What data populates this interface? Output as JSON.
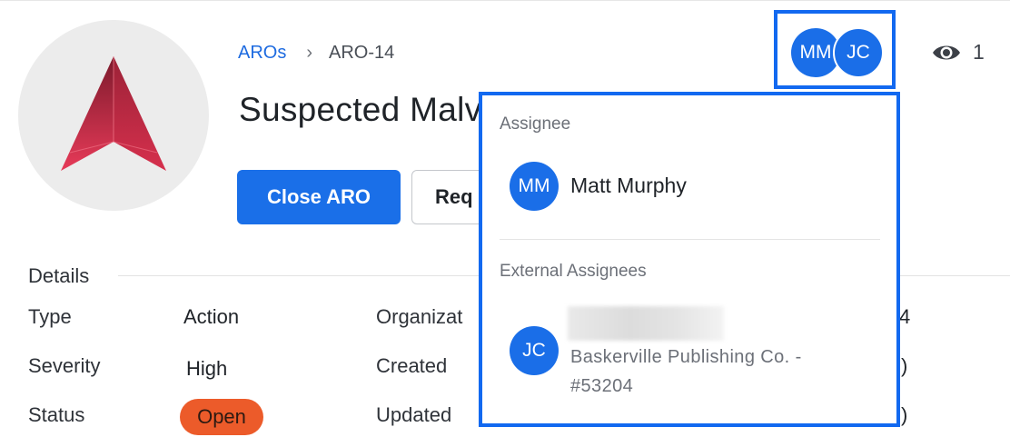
{
  "breadcrumb": {
    "parent": "AROs",
    "separator": "›",
    "current": "ARO-14"
  },
  "title": "Suspected Malv",
  "actions": {
    "primary_label": "Close ARO",
    "secondary_label": "Req"
  },
  "details": {
    "heading": "Details",
    "rows": [
      {
        "label": "Type",
        "value": "Action"
      },
      {
        "label": "Severity",
        "value": "High"
      },
      {
        "label": "Status",
        "value": "Open"
      }
    ],
    "col2_labels": [
      "Organizat",
      "Created",
      "Updated"
    ],
    "col3_fragments": [
      "4",
      ")",
      ")"
    ]
  },
  "assignees": {
    "avatars": [
      "MM",
      "JC"
    ],
    "viewer_icon": "eye-icon",
    "viewer_count": "1"
  },
  "dropdown": {
    "assignee_heading": "Assignee",
    "assignee": {
      "initials": "MM",
      "name": "Matt Murphy"
    },
    "external_heading": "External Assignees",
    "external": {
      "initials": "JC",
      "org_line1": "Baskerville Publishing Co. -",
      "org_line2": "#53204"
    }
  },
  "colors": {
    "accent": "#1a6fe8",
    "focus_outline": "#1269f0",
    "status_open": "#ec5b2a",
    "logo_dark": "#8e1f33",
    "logo_light": "#ef4560"
  }
}
